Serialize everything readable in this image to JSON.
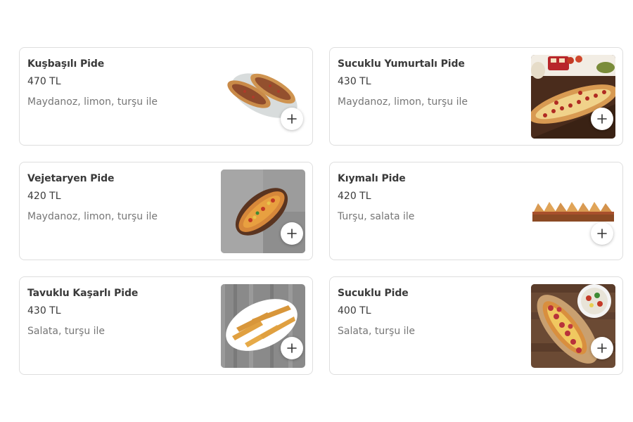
{
  "colors": {
    "card_border": "#dedede",
    "title_text": "#3a3a3a",
    "description_text": "#767676",
    "add_button_bg": "#ffffff"
  },
  "menu": {
    "items": [
      {
        "name": "Kuşbaşılı Pide",
        "price": "470 TL",
        "description": "Maydanoz, limon, turşu ile",
        "image": "kusbasili-pide-photo",
        "add_icon": "plus-icon"
      },
      {
        "name": "Sucuklu Yumurtalı Pide",
        "price": "430 TL",
        "description": "Maydanoz, limon, turşu ile",
        "image": "sucuklu-yumurtali-pide-photo",
        "add_icon": "plus-icon"
      },
      {
        "name": "Vejetaryen Pide",
        "price": "420 TL",
        "description": "Maydanoz, limon, turşu ile",
        "image": "vejetaryen-pide-photo",
        "add_icon": "plus-icon"
      },
      {
        "name": "Kıymalı Pide",
        "price": "420 TL",
        "description": "Turşu, salata ile",
        "image": "kiymali-pide-photo",
        "add_icon": "plus-icon"
      },
      {
        "name": "Tavuklu Kaşarlı Pide",
        "price": "430 TL",
        "description": "Salata, turşu ile",
        "image": "tavuklu-kasarli-pide-photo",
        "add_icon": "plus-icon"
      },
      {
        "name": "Sucuklu Pide",
        "price": "400 TL",
        "description": "Salata, turşu ile",
        "image": "sucuklu-pide-photo",
        "add_icon": "plus-icon"
      }
    ]
  }
}
